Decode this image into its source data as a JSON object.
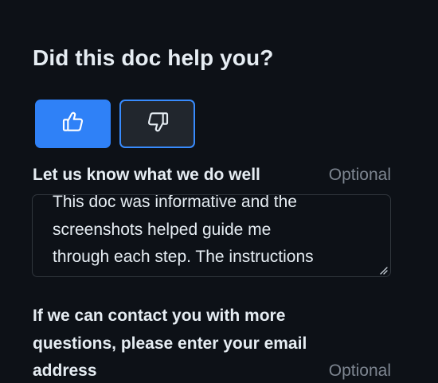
{
  "feedback": {
    "title": "Did this doc help you?",
    "thumbs_up": {
      "icon": "thumbs-up-icon",
      "selected": true
    },
    "thumbs_down": {
      "icon": "thumbs-down-icon",
      "selected": false
    },
    "comment": {
      "label": "Let us know what we do well",
      "optional": "Optional",
      "lines": [
        "This doc was informative and the",
        "screenshots helped guide me",
        "through each step. The instructions"
      ]
    },
    "email": {
      "label": "If we can contact you with more questions, please enter your email address",
      "optional": "Optional"
    }
  },
  "colors": {
    "background": "#0d1117",
    "accent": "#2f81f7",
    "muted_text": "#7d8590",
    "border": "#30363d"
  }
}
